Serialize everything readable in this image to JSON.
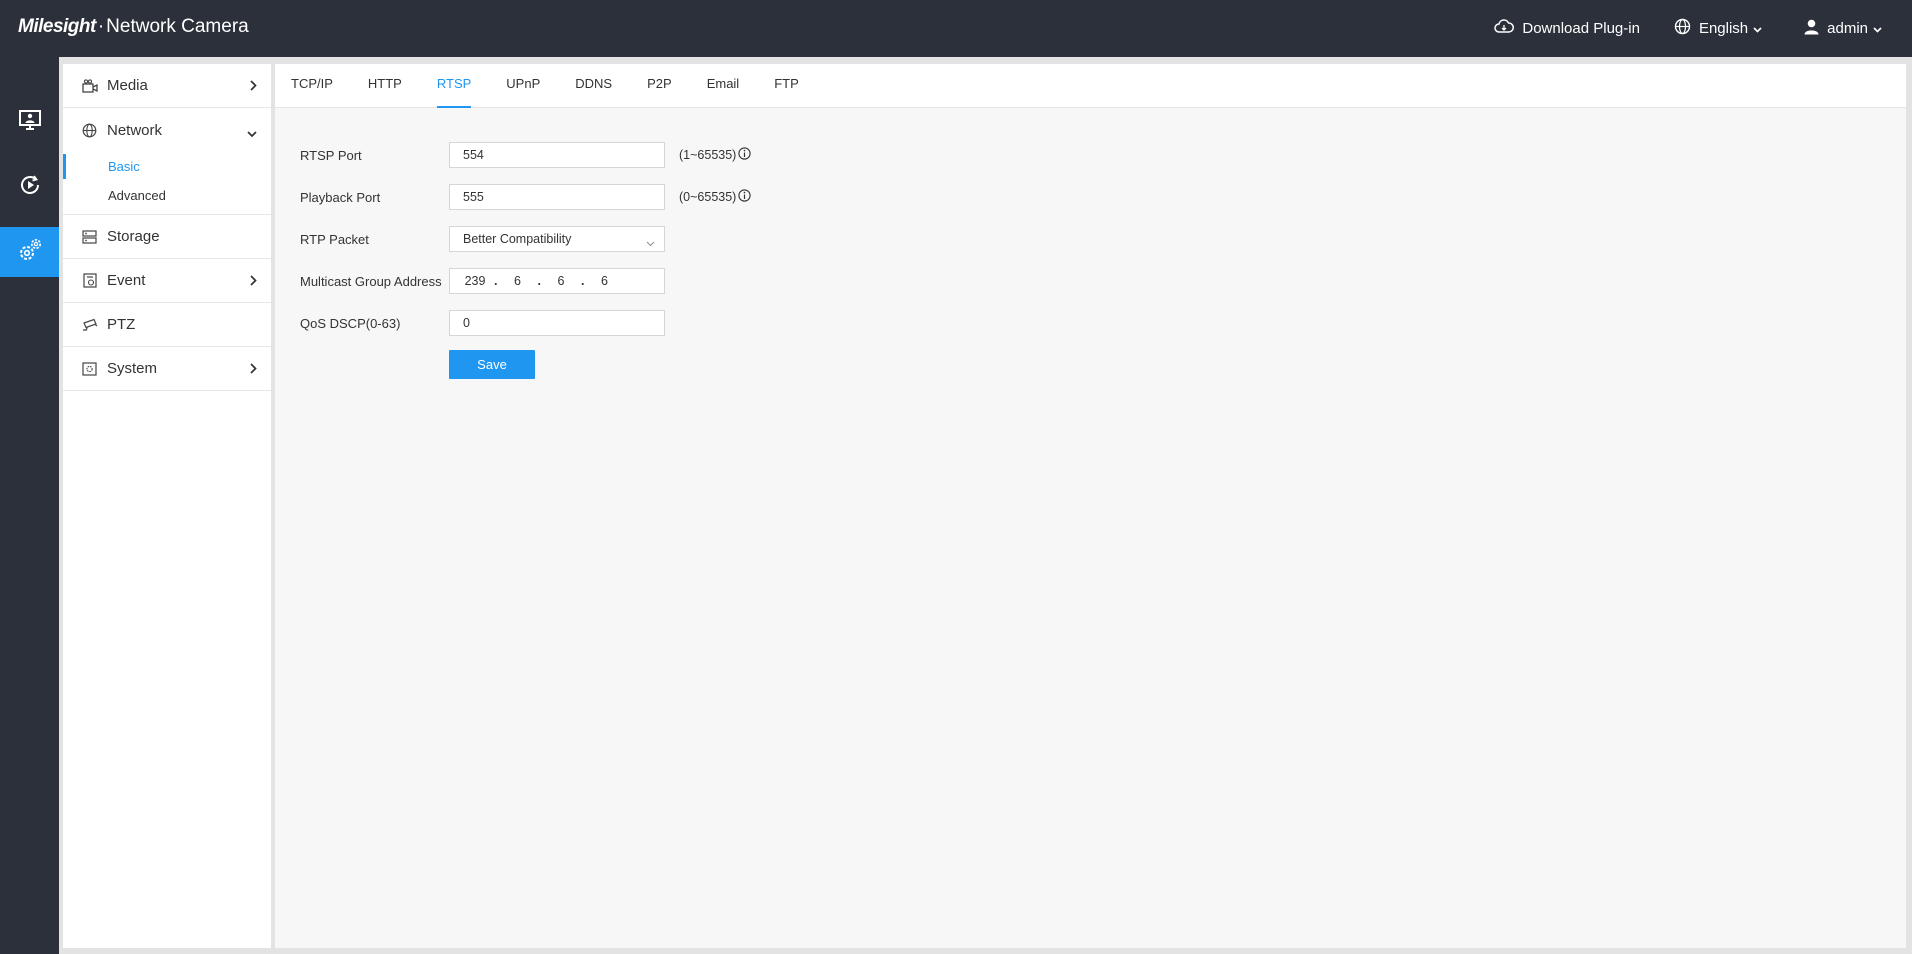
{
  "header": {
    "brand_logo": "Milesight",
    "brand_dot": "·",
    "brand_product": "Network Camera",
    "download_label": "Download Plug-in",
    "language_label": "English",
    "user_label": "admin"
  },
  "rail": {
    "items": [
      {
        "icon": "live-view-icon"
      },
      {
        "icon": "playback-icon"
      },
      {
        "icon": "settings-icon",
        "active": true
      }
    ]
  },
  "sidebar": {
    "media": "Media",
    "network": "Network",
    "network_sub": {
      "basic": "Basic",
      "advanced": "Advanced"
    },
    "storage": "Storage",
    "event": "Event",
    "ptz": "PTZ",
    "system": "System"
  },
  "tabs": [
    "TCP/IP",
    "HTTP",
    "RTSP",
    "UPnP",
    "DDNS",
    "P2P",
    "Email",
    "FTP"
  ],
  "active_tab": "RTSP",
  "form": {
    "rtsp_port": {
      "label": "RTSP Port",
      "value": "554",
      "hint": "(1~65535)"
    },
    "playback_port": {
      "label": "Playback Port",
      "value": "555",
      "hint": "(0~65535)"
    },
    "rtp_packet": {
      "label": "RTP Packet",
      "value": "Better Compatibility"
    },
    "multicast": {
      "label": "Multicast Group Address",
      "octets": [
        "239",
        "6",
        "6",
        "6"
      ],
      "separator": "."
    },
    "qos": {
      "label": "QoS DSCP(0-63)",
      "value": "0"
    },
    "save_label": "Save"
  },
  "colors": {
    "accent": "#1f96f0",
    "header_bg": "#2b303a"
  }
}
